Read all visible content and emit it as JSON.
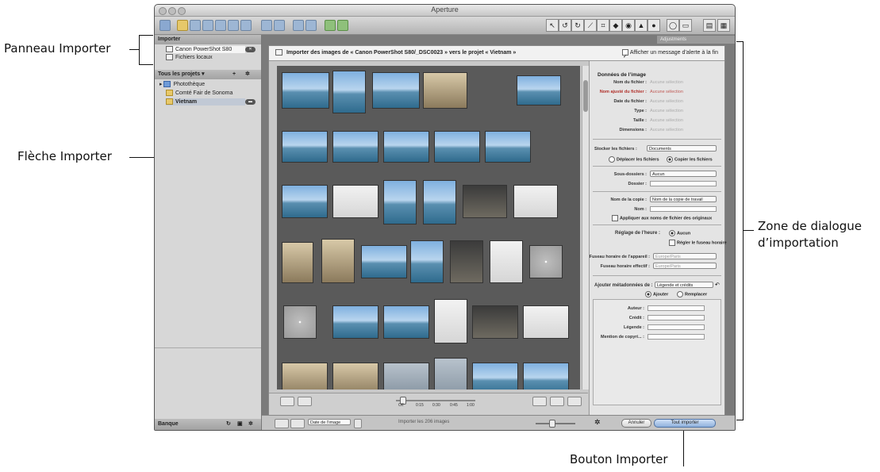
{
  "window": {
    "title": "Aperture"
  },
  "sidebar": {
    "import_header": "Importer",
    "import_items": [
      {
        "label": "Canon PowerShot S80"
      },
      {
        "label": "Fichiers locaux"
      }
    ],
    "projects_header": "Tous les projets",
    "project_items": [
      {
        "label": "Photothèque"
      },
      {
        "label": "Comté Fair de Sonoma"
      },
      {
        "label": "Vietnam"
      }
    ],
    "bottom_label": "Banque"
  },
  "importer": {
    "header_text": "Importer des images de « Canon PowerShot S80/_DSC0023 » vers le projet « Vietnam »",
    "alert_label": "Afficher un message d’alerte à la fin",
    "bottom": {
      "sort_label": "Date de l’image",
      "status": "Importer les 206 images",
      "timeline": [
        "Off",
        "0:15",
        "0:30",
        "0:45",
        "1:00"
      ]
    }
  },
  "image_data": {
    "section": "Données de l’image",
    "rows": [
      {
        "label": "Nom du fichier :",
        "value": "Aucune sélection"
      },
      {
        "label": "Nom ajusté du fichier :",
        "value": "Aucune sélection"
      },
      {
        "label": "Date du fichier :",
        "value": "Aucune sélection"
      },
      {
        "label": "Type :",
        "value": "Aucune sélection"
      },
      {
        "label": "Taille :",
        "value": "Aucune sélection"
      },
      {
        "label": "Dimensions :",
        "value": "Aucune sélection"
      }
    ]
  },
  "store": {
    "label": "Stocker les fichiers :",
    "value": "Documents",
    "move": "Déplacer les fichiers",
    "copy": "Copier les fichiers",
    "subfolders_label": "Sous-dossiers :",
    "subfolders_value": "Aucun",
    "folder_label": "Dossier :",
    "copy_name_label": "Nom de la copie :",
    "copy_name_value": "Nom de la copie de travail",
    "name_label": "Nom :",
    "apply_label": "Appliquer aux noms de fichier des originaux"
  },
  "time": {
    "label": "Réglage de l’heure :",
    "none": "Aucun",
    "tz": "Régler le fuseau horaire",
    "device_tz_label": "Fuseau horaire de l’appareil :",
    "device_tz_value": "Europe/Paris",
    "effective_tz_label": "Fuseau horaire effectif :",
    "effective_tz_value": "Europe/Paris"
  },
  "metadata": {
    "label": "Ajouter métadonnées de :",
    "value": "Légende et crédits",
    "add": "Ajouter",
    "replace": "Remplacer",
    "fields": [
      "Auteur :",
      "Crédit :",
      "Légende :",
      "Mention de copyri... :"
    ]
  },
  "buttons": {
    "cancel": "Annuler",
    "import_all": "Tout importer"
  },
  "adjustments": {
    "label": "Adjustments"
  },
  "callouts": {
    "panel": "Panneau Importer",
    "arrow": "Flèche Importer",
    "dialog_line1": "Zone de dialogue",
    "dialog_line2": "d’importation",
    "button": "Bouton Importer"
  }
}
